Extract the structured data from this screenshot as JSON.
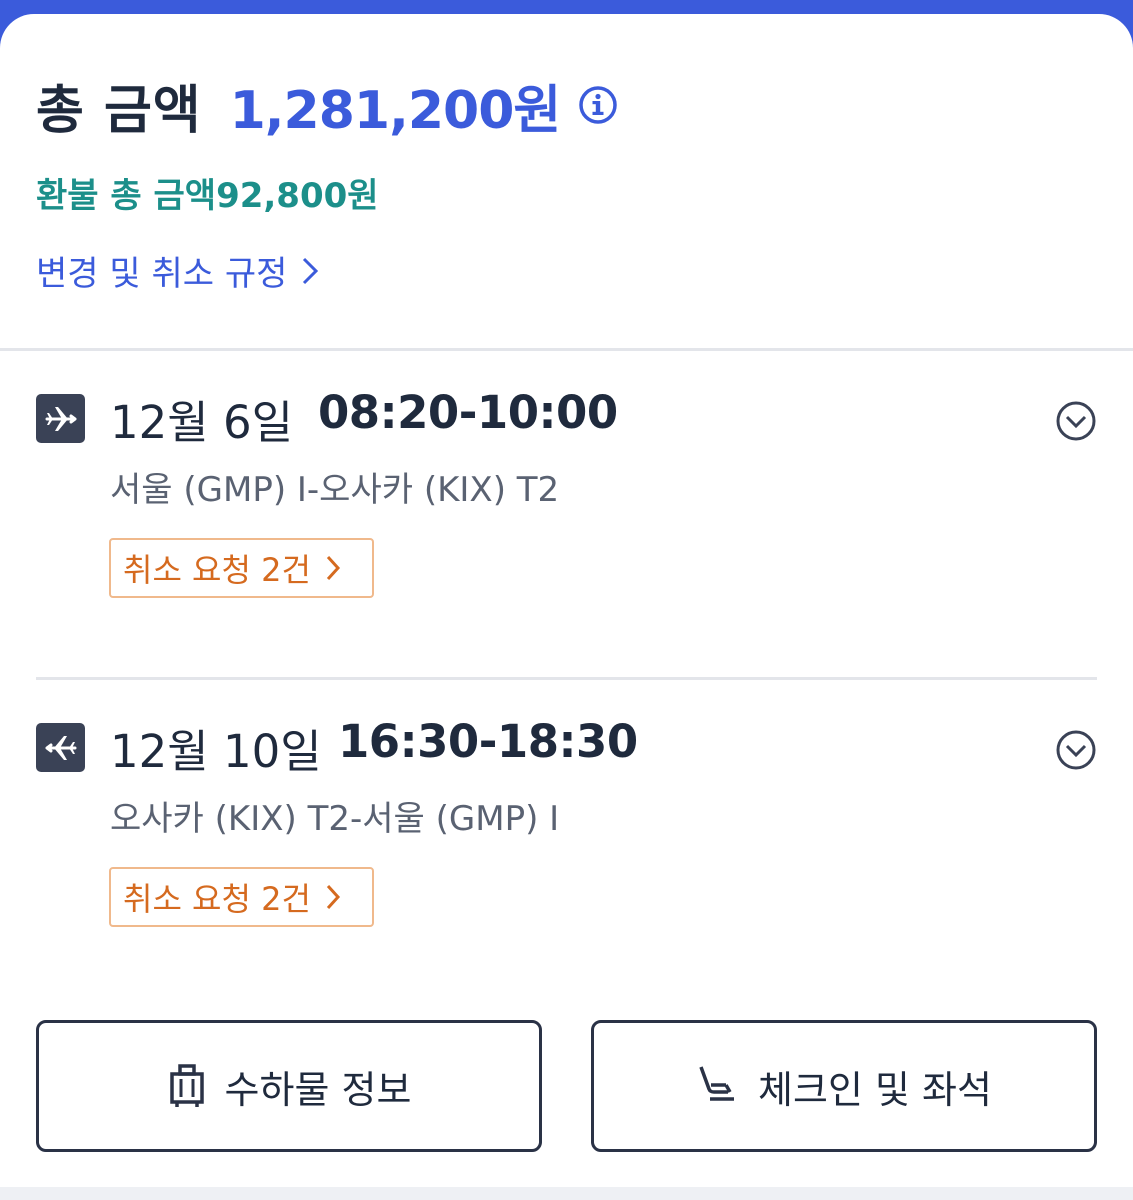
{
  "summary": {
    "total_label": "총 금액",
    "total_amount": "1,281,200원",
    "refund_text": "환불 총 금액92,800원",
    "policy_link": "변경 및 취소 규정"
  },
  "flights": [
    {
      "date": "12월 6일",
      "time": "08:20-10:00",
      "route": "서울 (GMP) I-오사카 (KIX) T2",
      "cancel_request": "취소 요청 2건"
    },
    {
      "date": "12월 10일",
      "time": "16:30-18:30",
      "route": "오사카 (KIX) T2-서울 (GMP) I",
      "cancel_request": "취소 요청 2건"
    }
  ],
  "actions": {
    "baggage_label": "수하물 정보",
    "checkin_label": "체크인 및 좌석"
  },
  "colors": {
    "accent": "#3b5bdb",
    "refund": "#1c8f8a",
    "cancel": "#d56a1f",
    "text": "#1f2a3d"
  },
  "icons": {
    "info": "info-icon",
    "chevron": "chevron-right-icon",
    "departure": "airplane-departure-icon",
    "arrival": "airplane-return-icon",
    "expand": "chevron-down-circle-icon",
    "baggage": "luggage-icon",
    "seat": "seat-icon"
  }
}
